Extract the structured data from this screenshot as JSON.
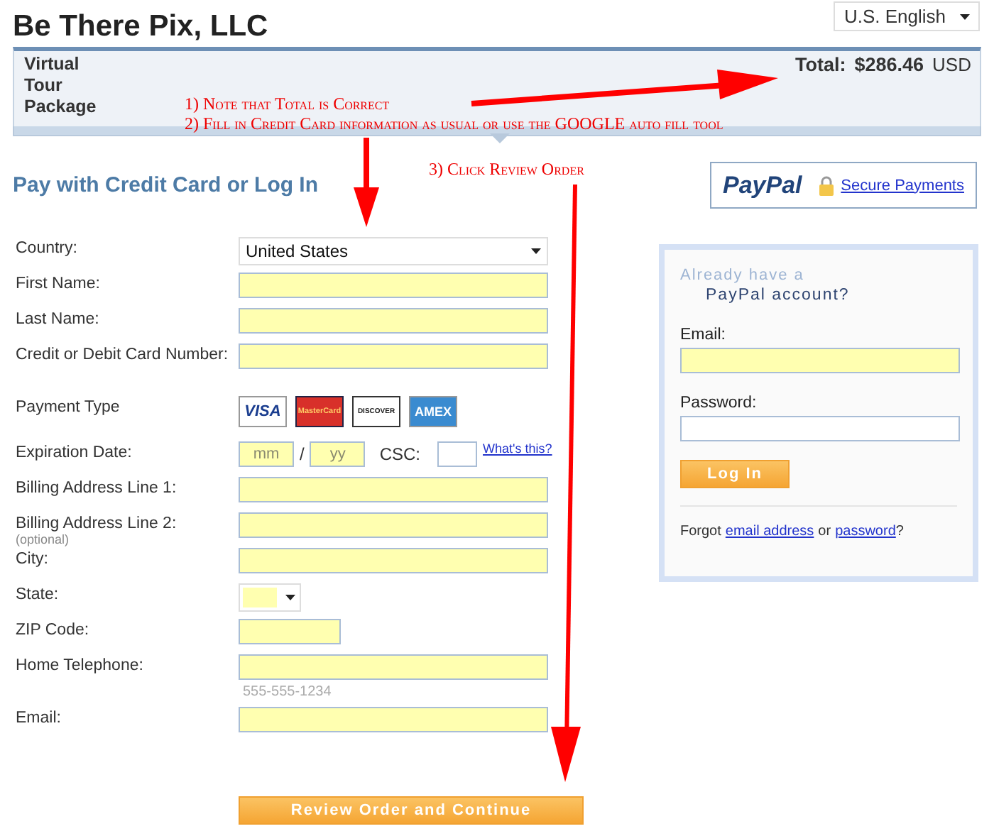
{
  "header": {
    "title": "Be There Pix, LLC",
    "language": "U.S. English"
  },
  "order_bar": {
    "item": "Virtual Tour Package",
    "total_label": "Total:",
    "total_amount": "$286.46",
    "currency": "USD"
  },
  "section_title": "Pay with Credit Card or Log In",
  "paypal_badge": {
    "logo": "PayPal",
    "link": "Secure Payments"
  },
  "form": {
    "rows": [
      {
        "kind": "select",
        "label": "Country:",
        "value": "United States"
      },
      {
        "kind": "text",
        "label": "First Name:",
        "autofill": true
      },
      {
        "kind": "text",
        "label": "Last Name:",
        "autofill": true
      },
      {
        "kind": "text",
        "label": "Credit or Debit Card Number:",
        "autofill": true
      },
      {
        "kind": "cards",
        "label": "Payment Type",
        "cards": [
          "VISA",
          "MasterCard",
          "DISCOVER",
          "AMEX"
        ]
      },
      {
        "kind": "expiry",
        "label": "Expiration Date:",
        "month": "mm",
        "separator": "/",
        "year": "yy",
        "csc_label": "CSC:",
        "csc_autofill": false,
        "help_link": "What's this?",
        "autofill": true
      },
      {
        "kind": "text",
        "label": "Billing Address Line 1:",
        "autofill": true
      },
      {
        "kind": "text",
        "label": "Billing Address Line 2:",
        "note": "(optional)",
        "autofill": true
      },
      {
        "kind": "text",
        "label": "City:",
        "autofill": true
      },
      {
        "kind": "state",
        "label": "State:",
        "autofill": true
      },
      {
        "kind": "zip",
        "label": "ZIP Code:",
        "autofill": true
      },
      {
        "kind": "text",
        "label": "Home Telephone:",
        "hint": "555-555-1234",
        "autofill": true
      },
      {
        "kind": "text",
        "label": "Email:",
        "autofill": true
      }
    ],
    "submit": "Review Order and Continue"
  },
  "login": {
    "heading_top": "Already have a",
    "heading_bottom": "PayPal account?",
    "fields": [
      {
        "label": "Email:",
        "autofill": true
      },
      {
        "label": "Password:",
        "autofill": false
      }
    ],
    "button": "Log In",
    "forgot_prefix": "Forgot",
    "forgot_link_1": "email address",
    "forgot_middle": "or",
    "forgot_link_2": "password",
    "forgot_suffix": "?"
  },
  "annotations": [
    {
      "text": "1) Note that Total is Correct"
    },
    {
      "text": "2) Fill in Credit Card information as usual or use the GOOGLE auto fill tool"
    },
    {
      "text": "3) Click Review Order"
    }
  ]
}
